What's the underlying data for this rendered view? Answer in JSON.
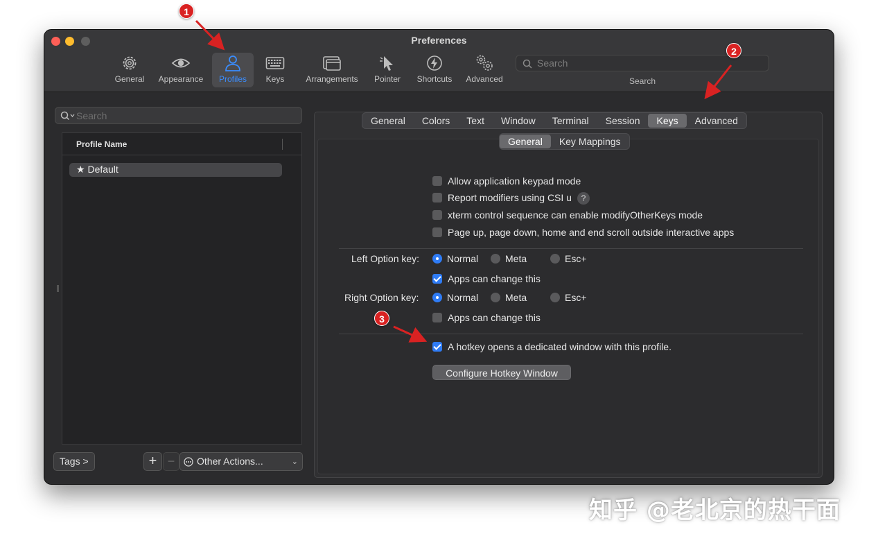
{
  "window": {
    "title": "Preferences"
  },
  "toolbar": {
    "items": [
      {
        "label": "General",
        "icon": "gear-icon",
        "active": false
      },
      {
        "label": "Appearance",
        "icon": "eye-icon",
        "active": false
      },
      {
        "label": "Profiles",
        "icon": "person-icon",
        "active": true
      },
      {
        "label": "Keys",
        "icon": "keyboard-icon",
        "active": false
      },
      {
        "label": "Arrangements",
        "icon": "windows-icon",
        "active": false
      },
      {
        "label": "Pointer",
        "icon": "pointer-icon",
        "active": false
      },
      {
        "label": "Shortcuts",
        "icon": "lightning-icon",
        "active": false
      },
      {
        "label": "Advanced",
        "icon": "gears-icon",
        "active": false
      }
    ],
    "search": {
      "placeholder": "Search",
      "caption": "Search"
    },
    "accent_color": "#3a8dff"
  },
  "profiles": {
    "search_placeholder": "Search",
    "column_header": "Profile Name",
    "rows": [
      {
        "star": "★",
        "name": "Default"
      }
    ],
    "tags_button": "Tags >",
    "add_button": "+",
    "remove_button": "−",
    "other_actions": "Other Actions..."
  },
  "tabs": {
    "main": [
      "General",
      "Colors",
      "Text",
      "Window",
      "Terminal",
      "Session",
      "Keys",
      "Advanced"
    ],
    "main_selected": "Keys",
    "sub": [
      "General",
      "Key Mappings"
    ],
    "sub_selected": "General"
  },
  "keys_general": {
    "checkboxes": [
      {
        "label": "Allow application keypad mode",
        "checked": false
      },
      {
        "label": "Report modifiers using CSI u",
        "checked": false,
        "help": "?"
      },
      {
        "label": "xterm control sequence can enable modifyOtherKeys mode",
        "checked": false
      },
      {
        "label": "Page up, page down, home and end scroll outside interactive apps",
        "checked": false
      }
    ],
    "left_option": {
      "label": "Left Option key:",
      "options": [
        "Normal",
        "Meta",
        "Esc+"
      ],
      "selected": "Normal",
      "apps_can_change": {
        "label": "Apps can change this",
        "checked": true
      }
    },
    "right_option": {
      "label": "Right Option key:",
      "options": [
        "Normal",
        "Meta",
        "Esc+"
      ],
      "selected": "Normal",
      "apps_can_change": {
        "label": "Apps can change this",
        "checked": false
      }
    },
    "hotkey": {
      "label": "A hotkey opens a dedicated window with this profile.",
      "checked": true
    },
    "configure_button": "Configure Hotkey Window",
    "checkbox_color": "#2f7cf6"
  },
  "annotations": {
    "badges": [
      "1",
      "2",
      "3"
    ],
    "color": "#d92222"
  },
  "watermark": "知乎 @老北京的热干面"
}
